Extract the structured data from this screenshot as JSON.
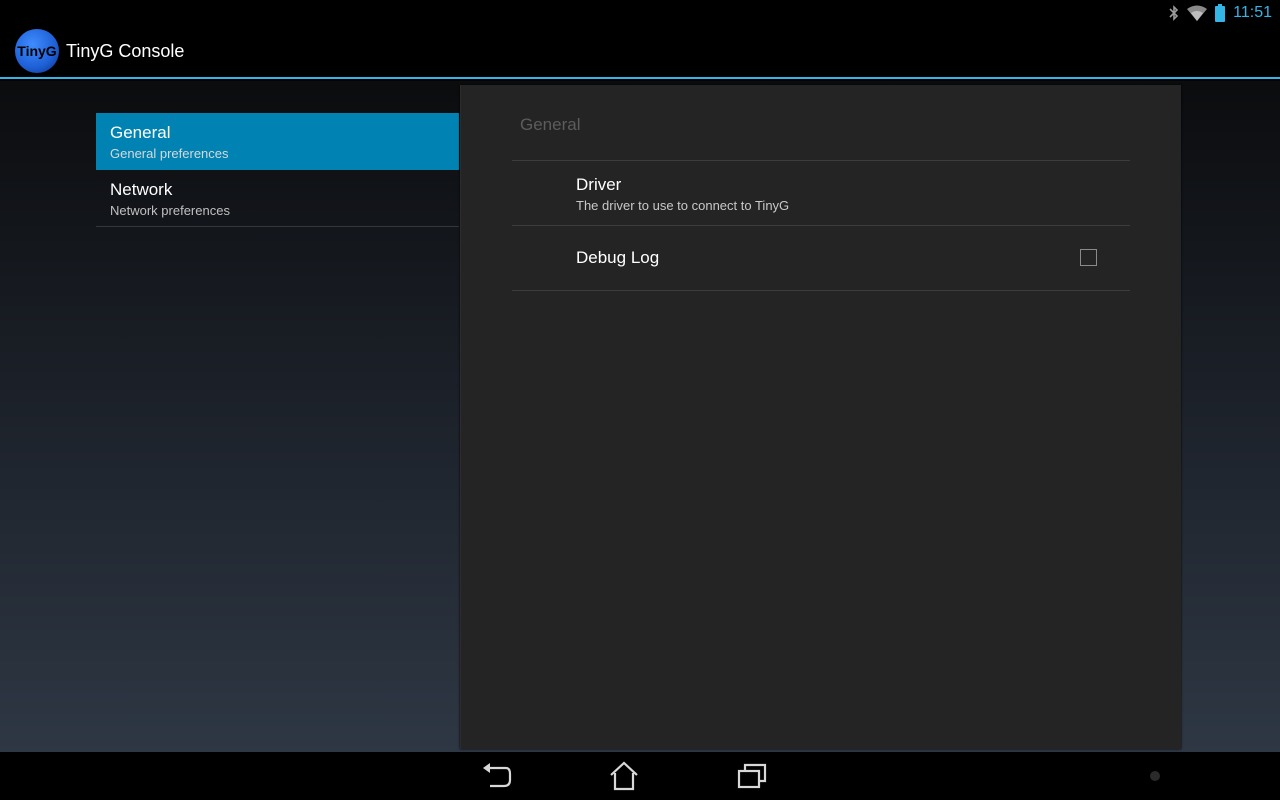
{
  "status_bar": {
    "time": "11:51",
    "icons": [
      "bluetooth-icon",
      "wifi-icon",
      "battery-icon"
    ],
    "accent": "#33b5e5"
  },
  "action_bar": {
    "logo_text": "TinyG",
    "title": "TinyG Console"
  },
  "headers": [
    {
      "title": "General",
      "summary": "General preferences",
      "selected": true
    },
    {
      "title": "Network",
      "summary": "Network preferences",
      "selected": false
    }
  ],
  "panel": {
    "category": "General",
    "preferences": [
      {
        "title": "Driver",
        "summary": "The driver to use to connect to TinyG"
      },
      {
        "title": "Debug Log",
        "checked": false
      }
    ]
  },
  "nav_bar": {
    "icons": [
      "back-icon",
      "home-icon",
      "recent-apps-icon"
    ]
  },
  "colors": {
    "selected": "#0083b3",
    "accent": "#33b5e5"
  }
}
